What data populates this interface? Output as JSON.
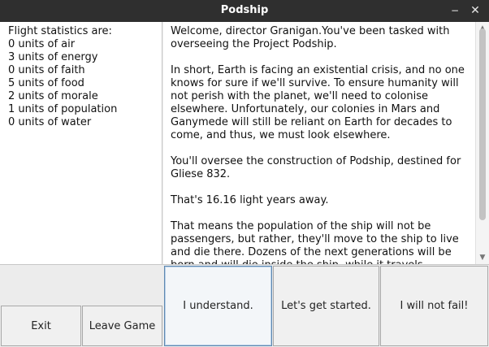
{
  "window": {
    "title": "Podship",
    "minimize_glyph": "−",
    "close_glyph": "✕"
  },
  "stats": {
    "heading": "Flight statistics are:",
    "items": [
      "0 units of air",
      "3 units of energy",
      "0 units of faith",
      "5 units of food",
      "2 units of morale",
      "1 units of population",
      "0 units of water"
    ]
  },
  "story": {
    "paragraphs": [
      "Welcome, director Granigan.You've been tasked with overseeing the Project Podship.",
      "In short, Earth is facing an existential crisis, and no one knows for sure if we'll survive. To ensure humanity will not perish with the planet, we'll need to colonise elsewhere. Unfortunately, our colonies in Mars and Ganymede will still be reliant on Earth for decades to come, and thus, we must look elsewhere.",
      "You'll oversee the construction of Podship, destined for Gliese 832.",
      "That's 16.16 light years away.",
      "That means the population of the ship will not be passengers, but rather, they'll move to the ship to live and die there. Dozens of the next generations will be born and will die inside the ship, while it travels."
    ]
  },
  "buttons": {
    "exit": "Exit",
    "leave_game": "Leave Game",
    "choice_1": "I understand.",
    "choice_2": "Let's get started.",
    "choice_3": "I will not fail!"
  },
  "scrollbar": {
    "up_glyph": "▲",
    "down_glyph": "▼"
  }
}
